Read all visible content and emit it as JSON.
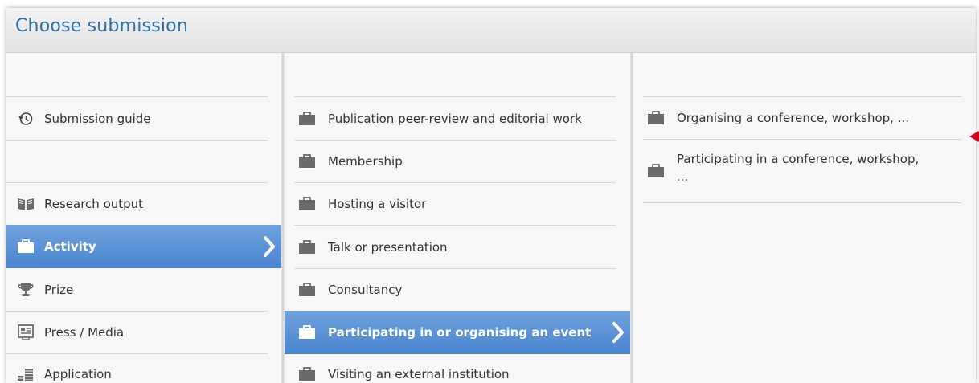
{
  "dialog": {
    "title": "Choose submission"
  },
  "column1": {
    "items": [
      {
        "label": "Submission guide",
        "icon": "history-icon"
      },
      {
        "label": "Research output",
        "icon": "book-icon"
      },
      {
        "label": "Activity",
        "icon": "briefcase-icon",
        "selected": true
      },
      {
        "label": "Prize",
        "icon": "trophy-icon"
      },
      {
        "label": "Press / Media",
        "icon": "newspaper-icon"
      },
      {
        "label": "Application",
        "icon": "coins-icon"
      }
    ]
  },
  "column2": {
    "items": [
      {
        "label": "Publication peer-review and editorial work",
        "icon": "briefcase-icon"
      },
      {
        "label": "Membership",
        "icon": "briefcase-icon"
      },
      {
        "label": "Hosting a visitor",
        "icon": "briefcase-icon"
      },
      {
        "label": "Talk or presentation",
        "icon": "briefcase-icon"
      },
      {
        "label": "Consultancy",
        "icon": "briefcase-icon"
      },
      {
        "label": "Participating in or organising an event",
        "icon": "briefcase-icon",
        "selected": true
      },
      {
        "label": "Visiting an external institution",
        "icon": "briefcase-icon"
      }
    ]
  },
  "column3": {
    "items": [
      {
        "label": "Organising a conference, workshop, ...",
        "icon": "briefcase-icon"
      },
      {
        "label_line1": "Participating in a conference, workshop,",
        "label_line2": "...",
        "icon": "briefcase-icon"
      }
    ]
  },
  "colors": {
    "accent": "#2f6fab",
    "selected_bg": "#5a93d6",
    "marker": "#d0021b"
  }
}
